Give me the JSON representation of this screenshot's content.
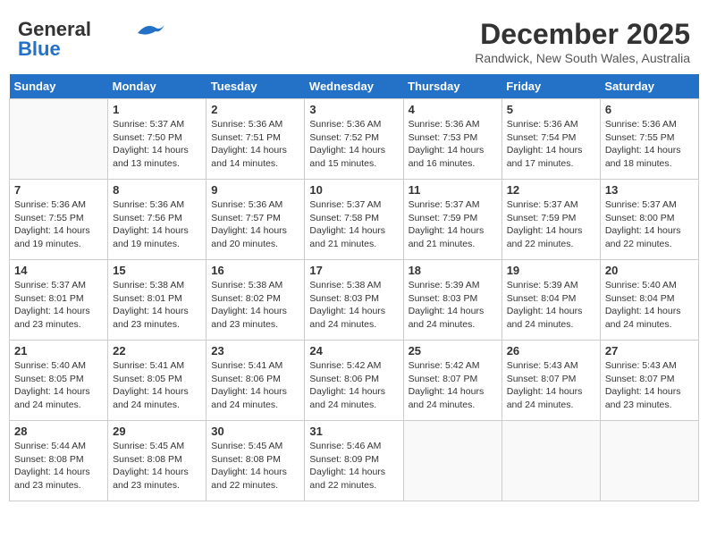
{
  "header": {
    "logo_general": "General",
    "logo_blue": "Blue",
    "month_title": "December 2025",
    "location": "Randwick, New South Wales, Australia"
  },
  "calendar": {
    "days_of_week": [
      "Sunday",
      "Monday",
      "Tuesday",
      "Wednesday",
      "Thursday",
      "Friday",
      "Saturday"
    ],
    "weeks": [
      [
        {
          "day": "",
          "info": ""
        },
        {
          "day": "1",
          "info": "Sunrise: 5:37 AM\nSunset: 7:50 PM\nDaylight: 14 hours\nand 13 minutes."
        },
        {
          "day": "2",
          "info": "Sunrise: 5:36 AM\nSunset: 7:51 PM\nDaylight: 14 hours\nand 14 minutes."
        },
        {
          "day": "3",
          "info": "Sunrise: 5:36 AM\nSunset: 7:52 PM\nDaylight: 14 hours\nand 15 minutes."
        },
        {
          "day": "4",
          "info": "Sunrise: 5:36 AM\nSunset: 7:53 PM\nDaylight: 14 hours\nand 16 minutes."
        },
        {
          "day": "5",
          "info": "Sunrise: 5:36 AM\nSunset: 7:54 PM\nDaylight: 14 hours\nand 17 minutes."
        },
        {
          "day": "6",
          "info": "Sunrise: 5:36 AM\nSunset: 7:55 PM\nDaylight: 14 hours\nand 18 minutes."
        }
      ],
      [
        {
          "day": "7",
          "info": "Sunrise: 5:36 AM\nSunset: 7:55 PM\nDaylight: 14 hours\nand 19 minutes."
        },
        {
          "day": "8",
          "info": "Sunrise: 5:36 AM\nSunset: 7:56 PM\nDaylight: 14 hours\nand 19 minutes."
        },
        {
          "day": "9",
          "info": "Sunrise: 5:36 AM\nSunset: 7:57 PM\nDaylight: 14 hours\nand 20 minutes."
        },
        {
          "day": "10",
          "info": "Sunrise: 5:37 AM\nSunset: 7:58 PM\nDaylight: 14 hours\nand 21 minutes."
        },
        {
          "day": "11",
          "info": "Sunrise: 5:37 AM\nSunset: 7:59 PM\nDaylight: 14 hours\nand 21 minutes."
        },
        {
          "day": "12",
          "info": "Sunrise: 5:37 AM\nSunset: 7:59 PM\nDaylight: 14 hours\nand 22 minutes."
        },
        {
          "day": "13",
          "info": "Sunrise: 5:37 AM\nSunset: 8:00 PM\nDaylight: 14 hours\nand 22 minutes."
        }
      ],
      [
        {
          "day": "14",
          "info": "Sunrise: 5:37 AM\nSunset: 8:01 PM\nDaylight: 14 hours\nand 23 minutes."
        },
        {
          "day": "15",
          "info": "Sunrise: 5:38 AM\nSunset: 8:01 PM\nDaylight: 14 hours\nand 23 minutes."
        },
        {
          "day": "16",
          "info": "Sunrise: 5:38 AM\nSunset: 8:02 PM\nDaylight: 14 hours\nand 23 minutes."
        },
        {
          "day": "17",
          "info": "Sunrise: 5:38 AM\nSunset: 8:03 PM\nDaylight: 14 hours\nand 24 minutes."
        },
        {
          "day": "18",
          "info": "Sunrise: 5:39 AM\nSunset: 8:03 PM\nDaylight: 14 hours\nand 24 minutes."
        },
        {
          "day": "19",
          "info": "Sunrise: 5:39 AM\nSunset: 8:04 PM\nDaylight: 14 hours\nand 24 minutes."
        },
        {
          "day": "20",
          "info": "Sunrise: 5:40 AM\nSunset: 8:04 PM\nDaylight: 14 hours\nand 24 minutes."
        }
      ],
      [
        {
          "day": "21",
          "info": "Sunrise: 5:40 AM\nSunset: 8:05 PM\nDaylight: 14 hours\nand 24 minutes."
        },
        {
          "day": "22",
          "info": "Sunrise: 5:41 AM\nSunset: 8:05 PM\nDaylight: 14 hours\nand 24 minutes."
        },
        {
          "day": "23",
          "info": "Sunrise: 5:41 AM\nSunset: 8:06 PM\nDaylight: 14 hours\nand 24 minutes."
        },
        {
          "day": "24",
          "info": "Sunrise: 5:42 AM\nSunset: 8:06 PM\nDaylight: 14 hours\nand 24 minutes."
        },
        {
          "day": "25",
          "info": "Sunrise: 5:42 AM\nSunset: 8:07 PM\nDaylight: 14 hours\nand 24 minutes."
        },
        {
          "day": "26",
          "info": "Sunrise: 5:43 AM\nSunset: 8:07 PM\nDaylight: 14 hours\nand 24 minutes."
        },
        {
          "day": "27",
          "info": "Sunrise: 5:43 AM\nSunset: 8:07 PM\nDaylight: 14 hours\nand 23 minutes."
        }
      ],
      [
        {
          "day": "28",
          "info": "Sunrise: 5:44 AM\nSunset: 8:08 PM\nDaylight: 14 hours\nand 23 minutes."
        },
        {
          "day": "29",
          "info": "Sunrise: 5:45 AM\nSunset: 8:08 PM\nDaylight: 14 hours\nand 23 minutes."
        },
        {
          "day": "30",
          "info": "Sunrise: 5:45 AM\nSunset: 8:08 PM\nDaylight: 14 hours\nand 22 minutes."
        },
        {
          "day": "31",
          "info": "Sunrise: 5:46 AM\nSunset: 8:09 PM\nDaylight: 14 hours\nand 22 minutes."
        },
        {
          "day": "",
          "info": ""
        },
        {
          "day": "",
          "info": ""
        },
        {
          "day": "",
          "info": ""
        }
      ]
    ]
  }
}
